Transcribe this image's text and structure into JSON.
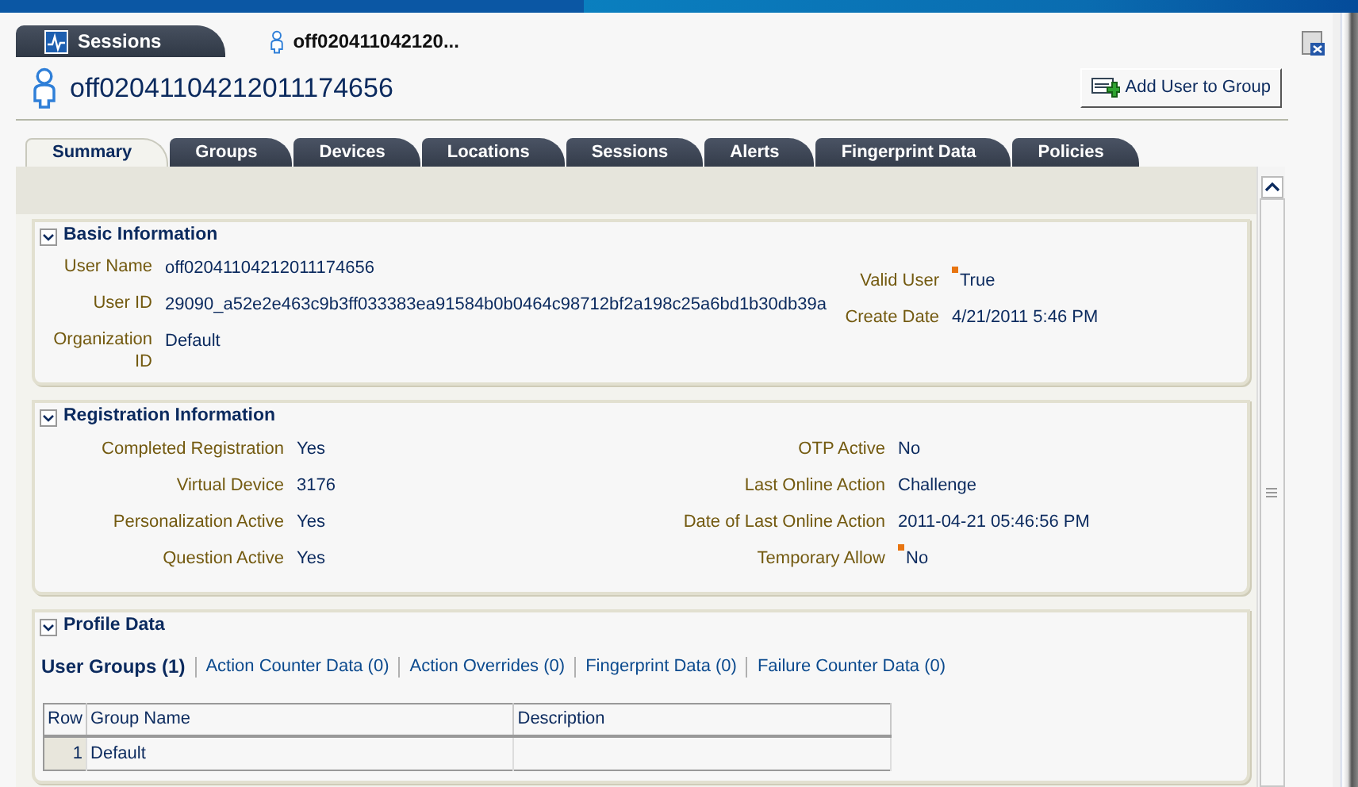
{
  "document_tabs": [
    {
      "label": "Sessions",
      "selected": false
    },
    {
      "label": "off020411042120...",
      "selected": true
    }
  ],
  "user": {
    "title": "off02041104212011174656"
  },
  "header_button": "Add User to Group",
  "tabs": [
    {
      "label": "Summary",
      "selected": true
    },
    {
      "label": "Groups",
      "selected": false
    },
    {
      "label": "Devices",
      "selected": false
    },
    {
      "label": "Locations",
      "selected": false
    },
    {
      "label": "Sessions",
      "selected": false
    },
    {
      "label": "Alerts",
      "selected": false
    },
    {
      "label": "Fingerprint Data",
      "selected": false
    },
    {
      "label": "Policies",
      "selected": false
    }
  ],
  "sections": [
    {
      "kind": "fields",
      "title": "Basic Information",
      "expanded": true,
      "left_fields": [
        {
          "label": "User Name",
          "value": "off02041104212011174656",
          "flagged": false
        },
        {
          "label": "User ID",
          "value": "29090_a52e2e463c9b3ff033383ea91584b0b0464c98712bf2a198c25a6bd1b30db39a",
          "flagged": false
        },
        {
          "label": "Organization ID",
          "value": "Default",
          "flagged": false
        }
      ],
      "right_fields": [
        {
          "label": "Valid User",
          "value": "True",
          "flagged": true
        },
        {
          "label": "Create Date",
          "value": "4/21/2011 5:46 PM",
          "flagged": false
        }
      ]
    },
    {
      "kind": "fields",
      "title": "Registration Information",
      "expanded": true,
      "left_fields": [
        {
          "label": "Completed Registration",
          "value": "Yes",
          "flagged": false
        },
        {
          "label": "Virtual Device",
          "value": "3176",
          "flagged": false
        },
        {
          "label": "Personalization Active",
          "value": "Yes",
          "flagged": false
        },
        {
          "label": "Question Active",
          "value": "Yes",
          "flagged": false
        }
      ],
      "right_fields": [
        {
          "label": "OTP Active",
          "value": "No",
          "flagged": false
        },
        {
          "label": "Last Online Action",
          "value": "Challenge",
          "flagged": false
        },
        {
          "label": "Date of Last Online Action",
          "value": "2011-04-21 05:46:56 PM",
          "flagged": false
        },
        {
          "label": "Temporary Allow",
          "value": "No",
          "flagged": true
        }
      ]
    },
    {
      "kind": "profile",
      "title": "Profile Data",
      "expanded": true,
      "subtabs": [
        {
          "label": "User Groups (1)",
          "selected": true
        },
        {
          "label": "Action Counter Data (0)",
          "selected": false
        },
        {
          "label": "Action Overrides (0)",
          "selected": false
        },
        {
          "label": "Fingerprint Data (0)",
          "selected": false
        },
        {
          "label": "Failure Counter Data (0)",
          "selected": false
        }
      ],
      "table": {
        "columns": [
          "Row",
          "Group Name",
          "Description"
        ],
        "rows": [
          {
            "row": "1",
            "group_name": "Default"
          }
        ]
      }
    }
  ]
}
